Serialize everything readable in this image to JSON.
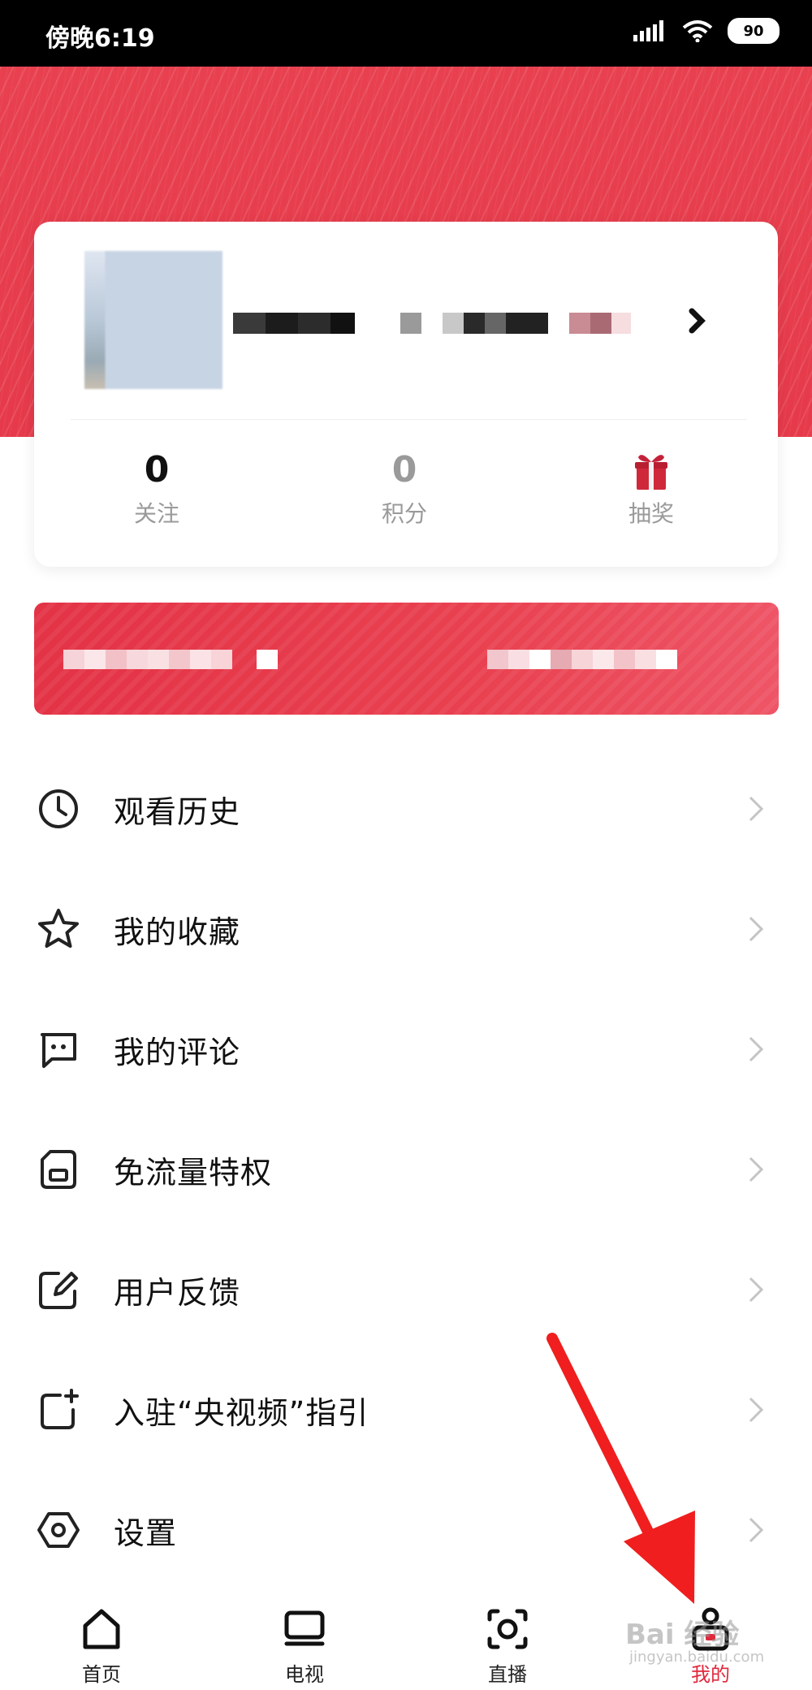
{
  "status_bar": {
    "time": "傍晚6:19",
    "battery": "90"
  },
  "profile": {
    "stats": [
      {
        "value": "0",
        "label": "关注"
      },
      {
        "value": "0",
        "label": "积分"
      },
      {
        "label": "抽奖",
        "icon": "gift-icon"
      }
    ]
  },
  "menu": [
    {
      "label": "观看历史",
      "icon": "clock-icon"
    },
    {
      "label": "我的收藏",
      "icon": "star-icon"
    },
    {
      "label": "我的评论",
      "icon": "comment-icon"
    },
    {
      "label": "免流量特权",
      "icon": "sim-card-icon"
    },
    {
      "label": "用户反馈",
      "icon": "edit-icon"
    },
    {
      "label": "入驻“央视频”指引",
      "icon": "add-square-icon"
    },
    {
      "label": "设置",
      "icon": "settings-hexagon-icon"
    }
  ],
  "tabs": [
    {
      "label": "首页",
      "icon": "home-icon"
    },
    {
      "label": "电视",
      "icon": "tv-icon"
    },
    {
      "label": "直播",
      "icon": "live-icon"
    },
    {
      "label": "我的",
      "icon": "profile-icon",
      "active": true
    }
  ],
  "watermark": {
    "text": "Bai 经验",
    "sub": "jingyan.baidu.com"
  },
  "colors": {
    "brand_red": "#e63a4a",
    "active_tab": "#e0283c",
    "arrow": "#f01e1e"
  }
}
